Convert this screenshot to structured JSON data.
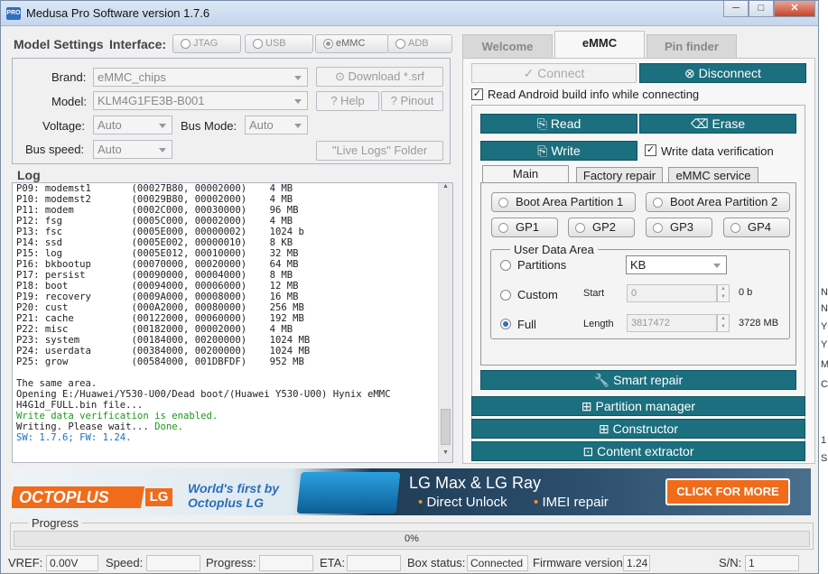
{
  "window": {
    "title": "Medusa Pro Software version 1.7.6",
    "app_badge": "PRO",
    "min": "─",
    "max": "□",
    "close": "✕"
  },
  "model_settings": {
    "group_title": "Model Settings",
    "interface_label": "Interface:",
    "interfaces": [
      "JTAG",
      "USB",
      "eMMC",
      "ADB"
    ],
    "brand_label": "Brand:",
    "brand_value": "eMMC_chips",
    "model_label": "Model:",
    "model_value": "KLM4G1FE3B-B001",
    "voltage_label": "Voltage:",
    "voltage_value": "Auto",
    "busmode_label": "Bus Mode:",
    "busmode_value": "Auto",
    "busspeed_label": "Bus speed:",
    "busspeed_value": "Auto",
    "download_srf": "Download *.srf",
    "help": "Help",
    "pinout": "Pinout",
    "live_logs": "\"Live Logs\" Folder"
  },
  "log": {
    "title": "Log",
    "lines": [
      "P09: modemst1       (00027B80, 00002000)    4 MB",
      "P10: modemst2       (00029B80, 00002000)    4 MB",
      "P11: modem          (0002C000, 00030000)    96 MB",
      "P12: fsg            (0005C000, 00002000)    4 MB",
      "P13: fsc            (0005E000, 00000002)    1024 b",
      "P14: ssd            (0005E002, 00000010)    8 KB",
      "P15: log            (0005E012, 00010000)    32 MB",
      "P16: bkbootup       (00070000, 00020000)    64 MB",
      "P17: persist        (00090000, 00004000)    8 MB",
      "P18: boot           (00094000, 00006000)    12 MB",
      "P19: recovery       (0009A000, 00008000)    16 MB",
      "P20: cust           (000A2000, 00080000)    256 MB",
      "P21: cache          (00122000, 00060000)    192 MB",
      "P22: misc           (00182000, 00002000)    4 MB",
      "P23: system         (00184000, 00200000)    1024 MB",
      "P24: userdata       (00384000, 00200000)    1024 MB",
      "P25: grow           (00584000, 001DBFDF)    952 MB"
    ],
    "msg1": "The same area.",
    "msg2": "Opening E:/Huawei/Y530-U00/Dead boot/(Huawei Y530-U00) Hynix eMMC",
    "msg3": "H4G1d_FULL.bin file...",
    "msg4": "Write data verification is enabled.",
    "msg5a": "Writing. Please wait... ",
    "msg5b": "Done.",
    "msg6": "SW: 1.7.6; FW: 1.24.",
    "colors": {
      "green": "#1a9a1a",
      "blue": "#1a6fc0"
    }
  },
  "tabs": [
    "Welcome",
    "eMMC",
    "Pin finder"
  ],
  "emmc": {
    "connect": "Connect",
    "disconnect": "Disconnect",
    "read_android": "Read Android build info while connecting",
    "read": "Read",
    "erase": "Erase",
    "write": "Write",
    "write_verify": "Write data verification",
    "subtabs": [
      "Main",
      "Factory repair",
      "eMMC service"
    ],
    "boot1": "Boot Area Partition 1",
    "boot2": "Boot Area Partition 2",
    "gp": [
      "GP1",
      "GP2",
      "GP3",
      "GP4"
    ],
    "user_area": "User Data Area",
    "partitions": "Partitions",
    "partitions_value": "KB",
    "custom": "Custom",
    "full": "Full",
    "start_label": "Start",
    "start_value": "0",
    "start_unit": "0 b",
    "length_label": "Length",
    "length_value": "3817472",
    "length_unit": "3728 MB",
    "smart_repair": "Smart repair",
    "partition_manager": "Partition manager",
    "constructor": "Constructor",
    "content_extractor": "Content extractor",
    "accent": "#1b6f7e"
  },
  "banner": {
    "brand": "OCTOPLUS",
    "lg": "LG",
    "tag1": "World's first by",
    "tag2": "Octoplus LG",
    "headline": "LG Max & LG Ray",
    "feature1": "Direct Unlock",
    "feature2": "IMEI repair",
    "cta": "CLICK FOR MORE"
  },
  "progress": {
    "title": "Progress",
    "value": "0%",
    "fraction": 0
  },
  "status": {
    "vref_label": "VREF:",
    "vref": "0.00V",
    "speed_label": "Speed:",
    "speed": "",
    "progress_label": "Progress:",
    "progress": "",
    "eta_label": "ETA:",
    "eta": "",
    "box_label": "Box status:",
    "box": "Connected",
    "fw_label": "Firmware version:",
    "fw": "1.24",
    "sn_label": "S/N:",
    "sn": "1"
  },
  "side_fragments": [
    "N",
    "N",
    "Y",
    "Y",
    "M",
    "C",
    "1",
    "S"
  ]
}
